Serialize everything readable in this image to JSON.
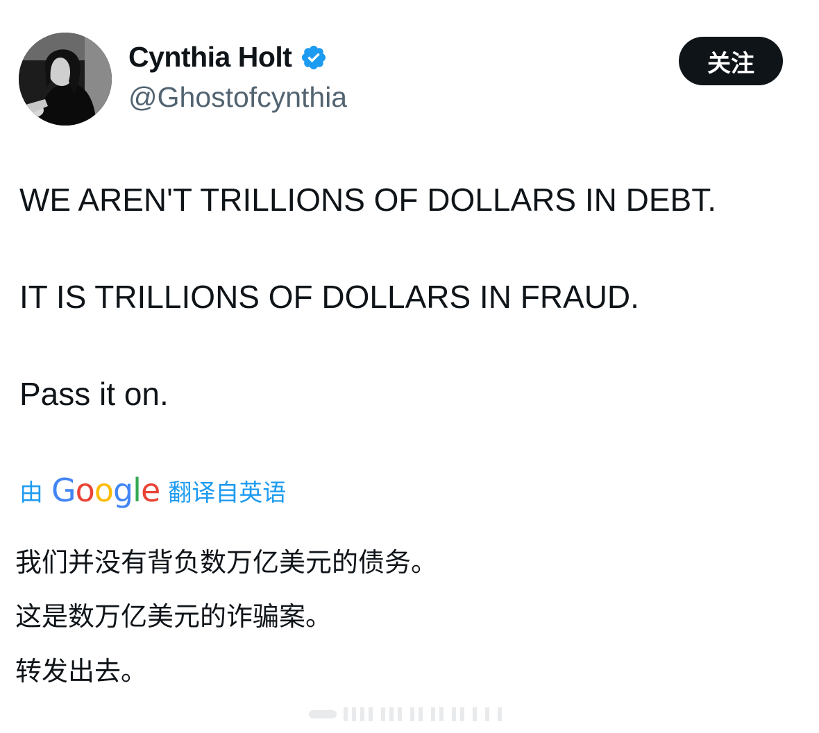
{
  "author": {
    "display_name": "Cynthia Holt",
    "handle": "@Ghostofcynthia",
    "verified_icon": "verified-badge-icon",
    "verified_color": "#1d9bf0"
  },
  "follow_button": {
    "label": "关注"
  },
  "tweet": {
    "lines": [
      "WE AREN'T TRILLIONS OF DOLLARS IN DEBT.",
      "IT IS TRILLIONS OF DOLLARS IN FRAUD.",
      "Pass it on."
    ]
  },
  "translation": {
    "by_label": "由",
    "provider": "Google",
    "from_label": "翻译自英语",
    "lines": [
      "我们并没有背负数万亿美元的债务。",
      "这是数万亿美元的诈骗案。",
      "转发出去。"
    ]
  },
  "colors": {
    "text": "#0f1419",
    "secondary": "#536471",
    "accent": "#1d9bf0",
    "button_bg": "#0f1419",
    "button_text": "#ffffff"
  }
}
